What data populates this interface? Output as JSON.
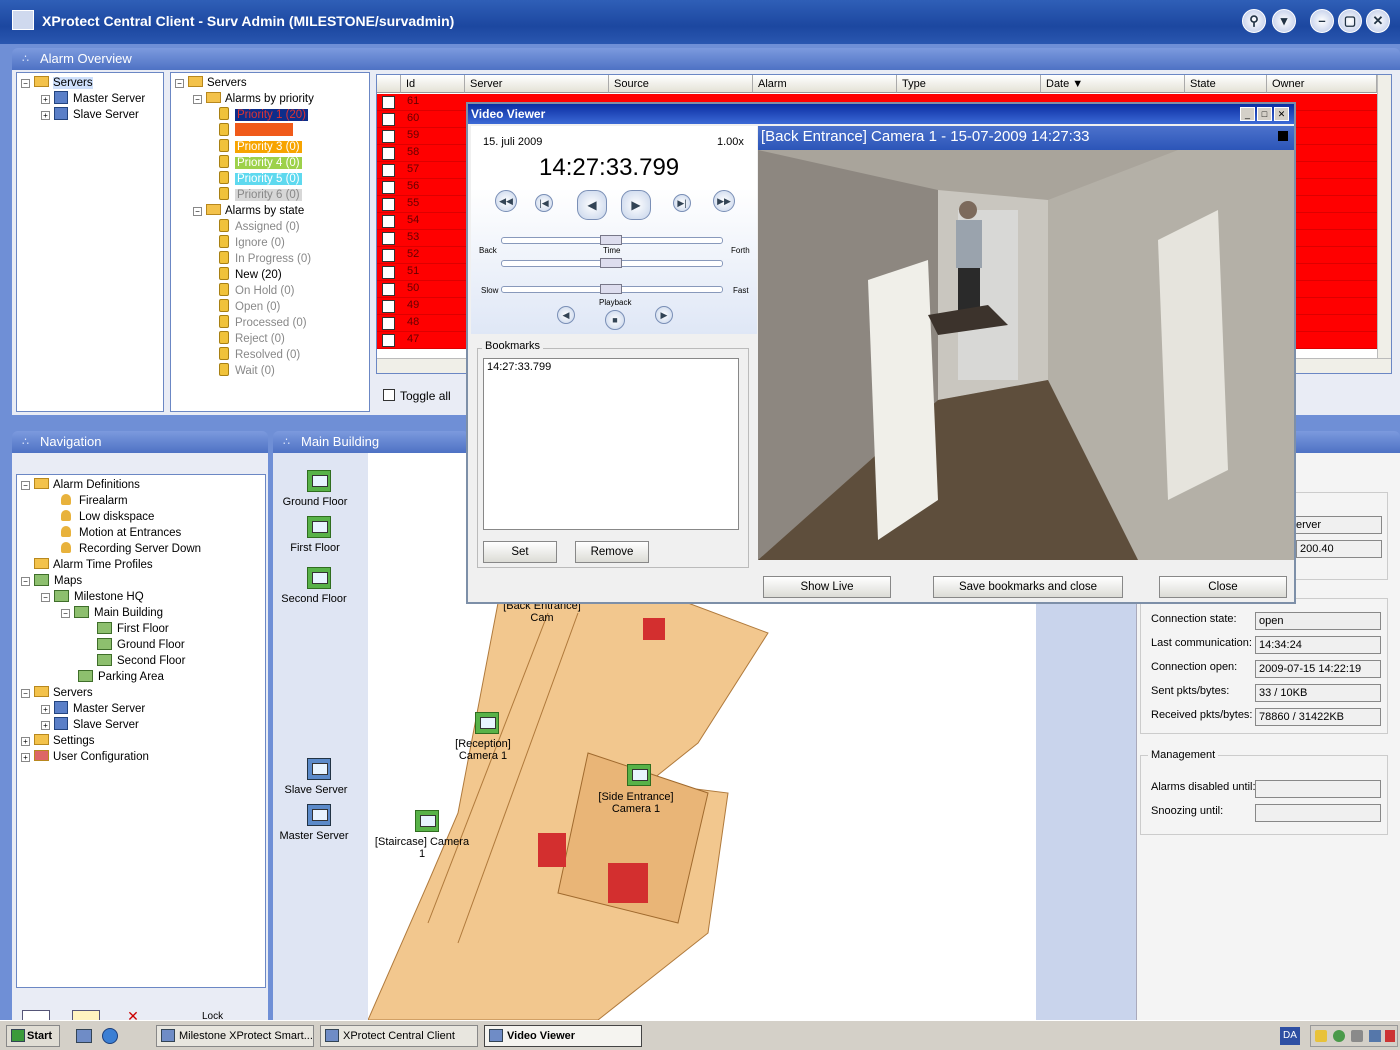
{
  "window": {
    "title": "XProtect Central Client  -  Surv Admin (MILESTONE/survadmin)"
  },
  "alarm_overview": {
    "title": "Alarm Overview",
    "server_tree": [
      "Servers",
      "Master Server",
      "Slave Server"
    ],
    "priority_tree": {
      "root": "Servers",
      "by_priority": "Alarms by priority",
      "priorities": [
        "Priority 1 (20)",
        "",
        "Priority 3 (0)",
        "Priority 4 (0)",
        "Priority 5 (0)",
        "Priority 6 (0)"
      ],
      "by_state": "Alarms by state",
      "states": [
        "Assigned (0)",
        "Ignore (0)",
        "In Progress (0)",
        "New (20)",
        "On Hold (0)",
        "Open (0)",
        "Processed (0)",
        "Reject (0)",
        "Resolved (0)",
        "Wait (0)"
      ]
    },
    "columns": [
      "Id",
      "Server",
      "Source",
      "Alarm",
      "Type",
      "Date ▼",
      "State",
      "Owner"
    ],
    "ids": [
      "61",
      "60",
      "59",
      "58",
      "57",
      "56",
      "55",
      "54",
      "53",
      "52",
      "51",
      "50",
      "49",
      "48",
      "47"
    ],
    "toggle_all": "Toggle all"
  },
  "navigation": {
    "title": "Navigation",
    "items": [
      "Alarm Definitions",
      "Firealarm",
      "Low diskspace",
      "Motion at Entrances",
      "Recording Server Down",
      "Alarm Time Profiles",
      "Maps",
      "Milestone HQ",
      "Main Building",
      "First Floor",
      "Ground Floor",
      "Second Floor",
      "Parking Area",
      "Servers",
      "Master Server",
      "Slave Server",
      "Settings",
      "User Configuration"
    ],
    "lock": "Lock"
  },
  "map": {
    "title": "Main Building",
    "floors": [
      "Ground Floor",
      "First Floor",
      "Second Floor"
    ],
    "servers": [
      "Slave Server",
      "Master Server"
    ],
    "cameras": [
      "[Back Entrance] Cam",
      "[Reception] Camera 1",
      "[Side Entrance] Camera 1",
      "[Staircase] Camera 1"
    ]
  },
  "video_viewer": {
    "title": "Video Viewer",
    "date": "15. juli 2009",
    "speed": "1.00x",
    "time": "14:27:33.799",
    "time_label": "Time",
    "back": "Back",
    "forth": "Forth",
    "slow": "Slow",
    "fast": "Fast",
    "playback": "Playback",
    "bookmarks_label": "Bookmarks",
    "bookmark_entry": "14:27:33.799",
    "set": "Set",
    "remove": "Remove",
    "video_caption": "[Back Entrance] Camera 1 - 15-07-2009 14:27:33",
    "show_live": "Show Live",
    "save_close": "Save bookmarks and close",
    "close": "Close"
  },
  "server_info": {
    "server_field": "erver",
    "ip_field": "200.40",
    "connection_state_label": "Connection state:",
    "connection_state": "open",
    "last_comm_label": "Last communication:",
    "last_comm": "14:34:24",
    "conn_open_label": "Connection open:",
    "conn_open": "2009-07-15 14:22:19",
    "sent_label": "Sent pkts/bytes:",
    "sent": "33 / 10KB",
    "received_label": "Received pkts/bytes:",
    "received": "78860 / 31422KB",
    "management": "Management",
    "alarms_disabled": "Alarms disabled until:",
    "snoozing": "Snoozing until:"
  },
  "taskbar": {
    "start": "Start",
    "tasks": [
      "Milestone XProtect Smart...",
      "XProtect Central Client",
      "Video Viewer"
    ],
    "lang": "DA"
  }
}
